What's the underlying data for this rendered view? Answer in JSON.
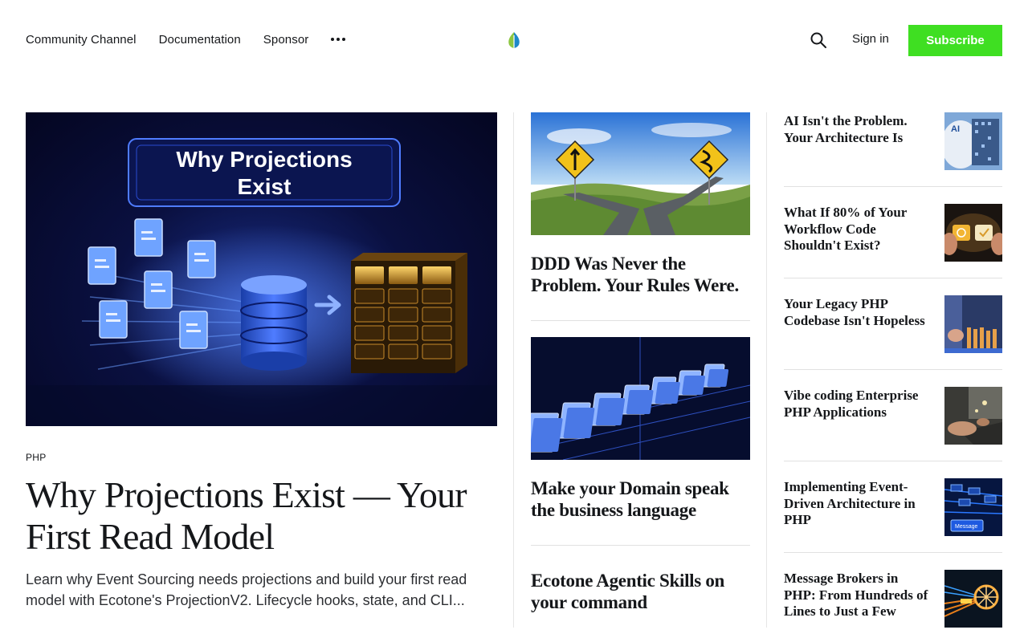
{
  "nav": {
    "items": [
      "Community Channel",
      "Documentation",
      "Sponsor"
    ],
    "signin_label": "Sign in",
    "subscribe_label": "Subscribe",
    "accent_color": "#3fdf22"
  },
  "featured": {
    "image_text_line1": "Why Projections",
    "image_text_line2": "Exist",
    "tag": "PHP",
    "title": "Why Projections Exist — Your First Read Model",
    "excerpt": "Learn why Event Sourcing needs projections and build your first read model with Ecotone's ProjectionV2. Lifecycle hooks, state, and CLI..."
  },
  "middle": [
    {
      "title": "DDD Was Never the Problem. Your Rules Were."
    },
    {
      "title": "Make your Domain speak the business language"
    },
    {
      "title": "Ecotone Agentic Skills on your command"
    }
  ],
  "side": [
    {
      "title": "AI Isn't the Problem. Your Architecture Is",
      "thumb_text": "AI"
    },
    {
      "title": "What If 80% of Your Workflow Code Shouldn't Exist?"
    },
    {
      "title": "Your Legacy PHP Codebase Isn't Hopeless"
    },
    {
      "title": "Vibe coding Enterprise PHP Applications"
    },
    {
      "title": "Implementing Event-Driven Architecture in PHP",
      "thumb_text": "Message"
    },
    {
      "title": "Message Brokers in PHP: From Hundreds of Lines to Just a Few"
    }
  ]
}
